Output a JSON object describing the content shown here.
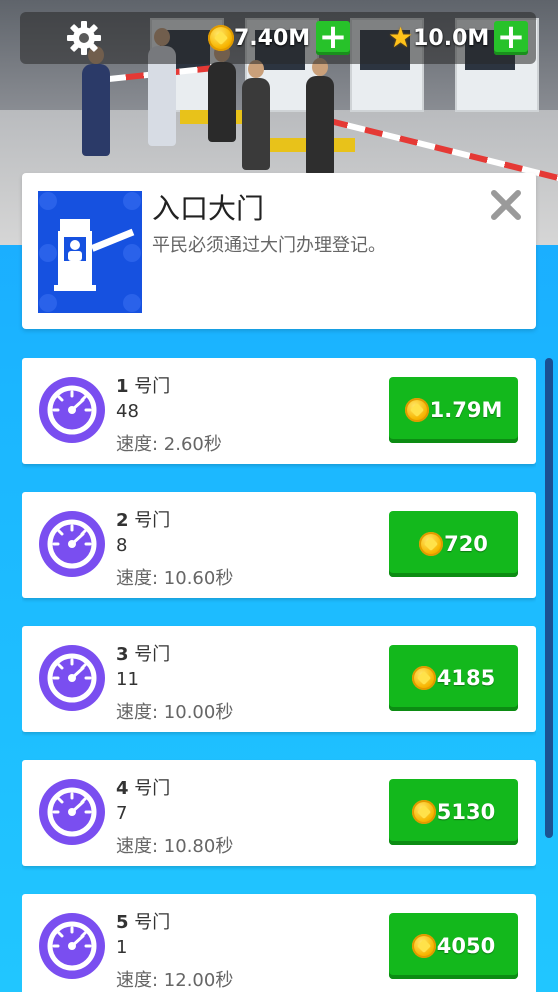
{
  "hud": {
    "coins": "7.40M",
    "stars": "10.0M",
    "add_coins_label": "+",
    "add_stars_label": "+"
  },
  "info": {
    "title": "入口大门",
    "description": "平民必须通过大门办理登记。",
    "close_label": "✕"
  },
  "gates": [
    {
      "num": "1",
      "suffix": " 号门",
      "level": "48",
      "speed": "速度: 2.60秒",
      "price": "1.79M"
    },
    {
      "num": "2",
      "suffix": " 号门",
      "level": "8",
      "speed": "速度: 10.60秒",
      "price": "720"
    },
    {
      "num": "3",
      "suffix": " 号门",
      "level": "11",
      "speed": "速度: 10.00秒",
      "price": "4185"
    },
    {
      "num": "4",
      "suffix": " 号门",
      "level": "7",
      "speed": "速度: 10.80秒",
      "price": "5130"
    },
    {
      "num": "5",
      "suffix": " 号门",
      "level": "1",
      "speed": "速度: 12.00秒",
      "price": "4050"
    }
  ],
  "colors": {
    "background": "#1aa3ff",
    "buy_button": "#13b81c",
    "plus_button": "#27c22a",
    "gauge": "#7a4ef0",
    "thumb": "#1651e0"
  },
  "icons": {
    "settings": "gear-icon",
    "coin": "coin-icon",
    "star": "star-icon",
    "close": "close-icon",
    "gauge": "speedometer-icon",
    "gate": "barrier-gate-icon"
  }
}
